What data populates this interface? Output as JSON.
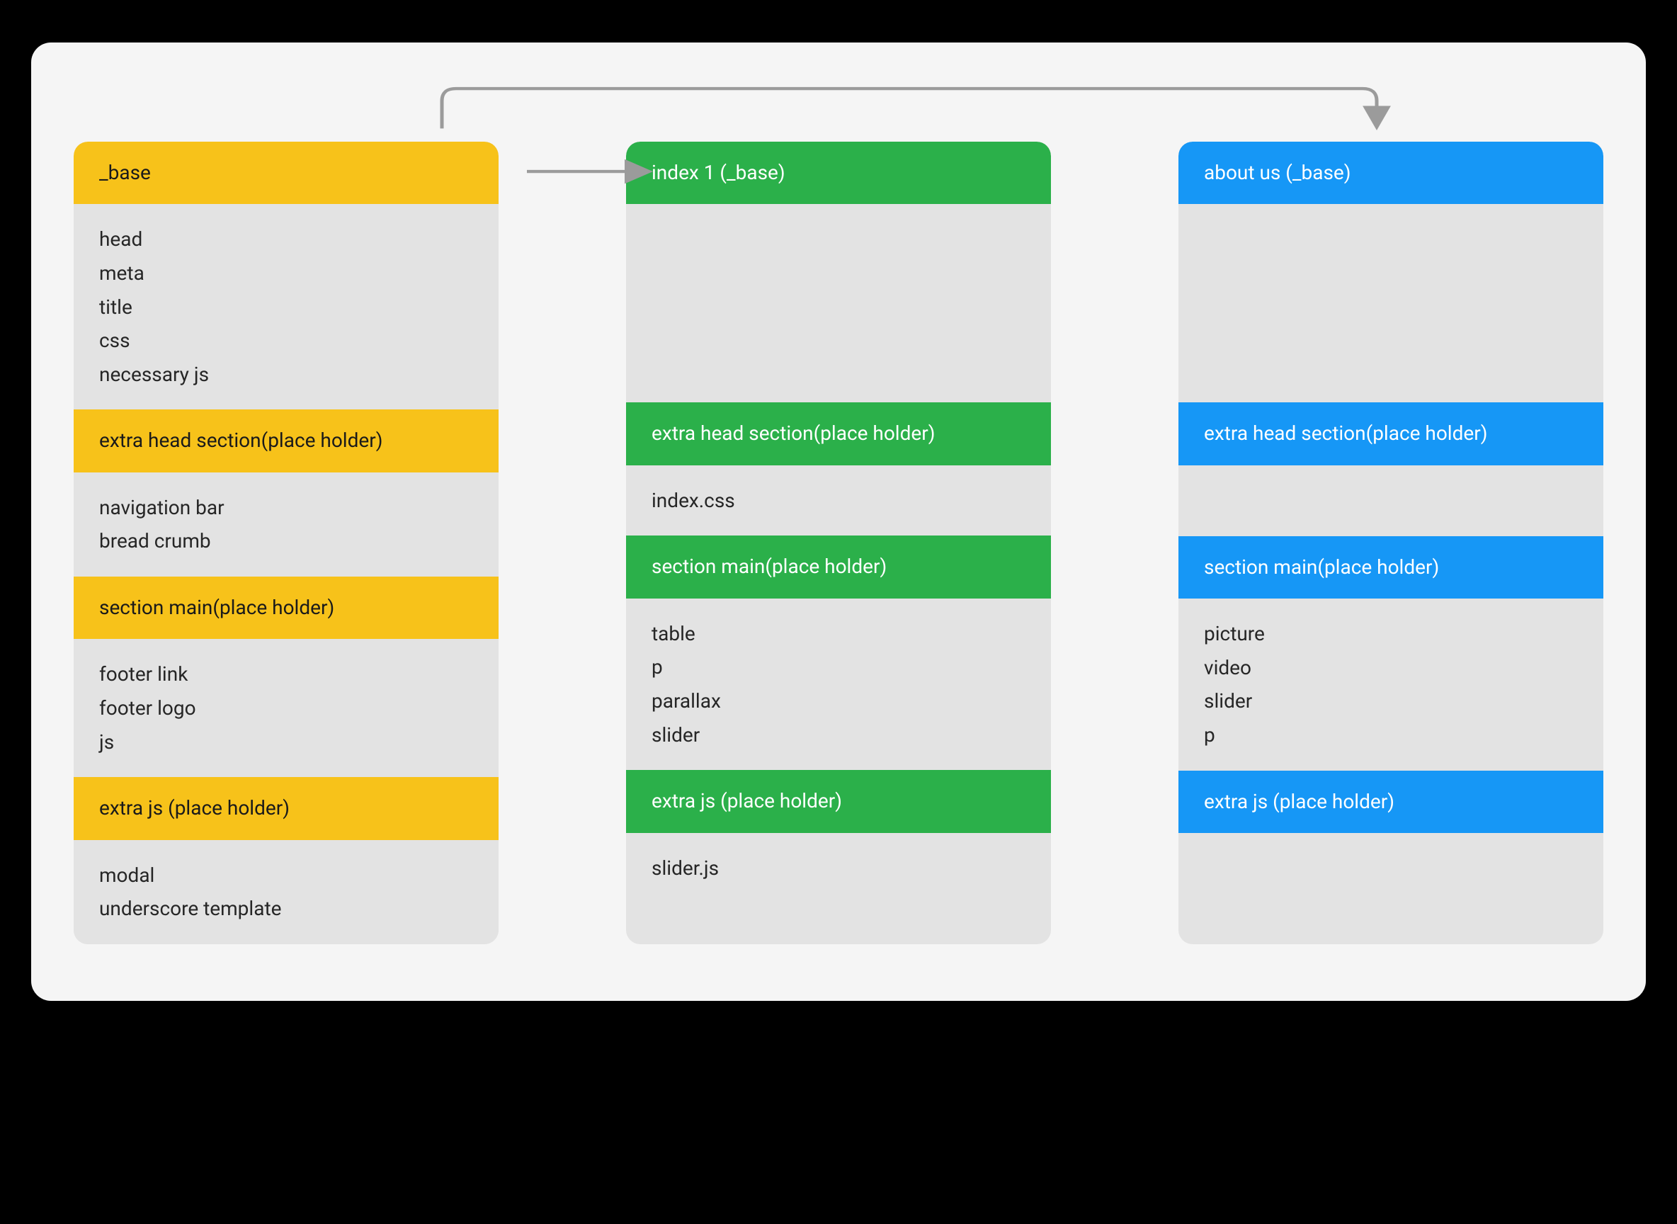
{
  "colors": {
    "yellow": "#f7c21a",
    "green": "#2bb04a",
    "blue": "#1697f6",
    "canvas": "#f5f5f5",
    "cell": "#e3e3e3",
    "arrow": "#9b9b9b"
  },
  "columns": [
    {
      "id": "base",
      "theme": "yellow",
      "title": "_base",
      "sections": [
        {
          "type": "body",
          "lines": [
            "head",
            "meta",
            "title",
            "css",
            "necessary js"
          ]
        },
        {
          "type": "header",
          "label": "extra head section(place holder)"
        },
        {
          "type": "body",
          "lines": [
            "navigation bar",
            "bread crumb"
          ]
        },
        {
          "type": "header",
          "label": "section main(place holder)"
        },
        {
          "type": "body",
          "lines": [
            "footer link",
            "footer logo",
            "js"
          ]
        },
        {
          "type": "header",
          "label": "extra js (place holder)"
        },
        {
          "type": "body",
          "lines": [
            "modal",
            "underscore template"
          ]
        }
      ]
    },
    {
      "id": "index",
      "theme": "green",
      "title": "index 1 (_base)",
      "sections": [
        {
          "type": "body",
          "variant": "tall",
          "lines": []
        },
        {
          "type": "header",
          "label": "extra head section(place holder)"
        },
        {
          "type": "body",
          "lines": [
            "index.css"
          ]
        },
        {
          "type": "header",
          "label": "section main(place holder)"
        },
        {
          "type": "body",
          "lines": [
            "table",
            "p",
            "parallax",
            "slider"
          ]
        },
        {
          "type": "header",
          "label": "extra js (place holder)"
        },
        {
          "type": "body",
          "lines": [
            "slider.js"
          ]
        }
      ]
    },
    {
      "id": "about",
      "theme": "blue",
      "title": "about us (_base)",
      "sections": [
        {
          "type": "body",
          "variant": "tall",
          "lines": []
        },
        {
          "type": "header",
          "label": "extra head section(place holder)"
        },
        {
          "type": "body",
          "variant": "short",
          "lines": []
        },
        {
          "type": "header",
          "label": "section main(place holder)"
        },
        {
          "type": "body",
          "lines": [
            "picture",
            "video",
            "slider",
            "p"
          ]
        },
        {
          "type": "header",
          "label": "extra js (place holder)"
        },
        {
          "type": "body",
          "variant": "short",
          "lines": []
        }
      ]
    }
  ],
  "arrows": [
    {
      "from": "base",
      "to": "index",
      "kind": "straight"
    },
    {
      "from": "base",
      "to": "about",
      "kind": "up-over"
    }
  ]
}
